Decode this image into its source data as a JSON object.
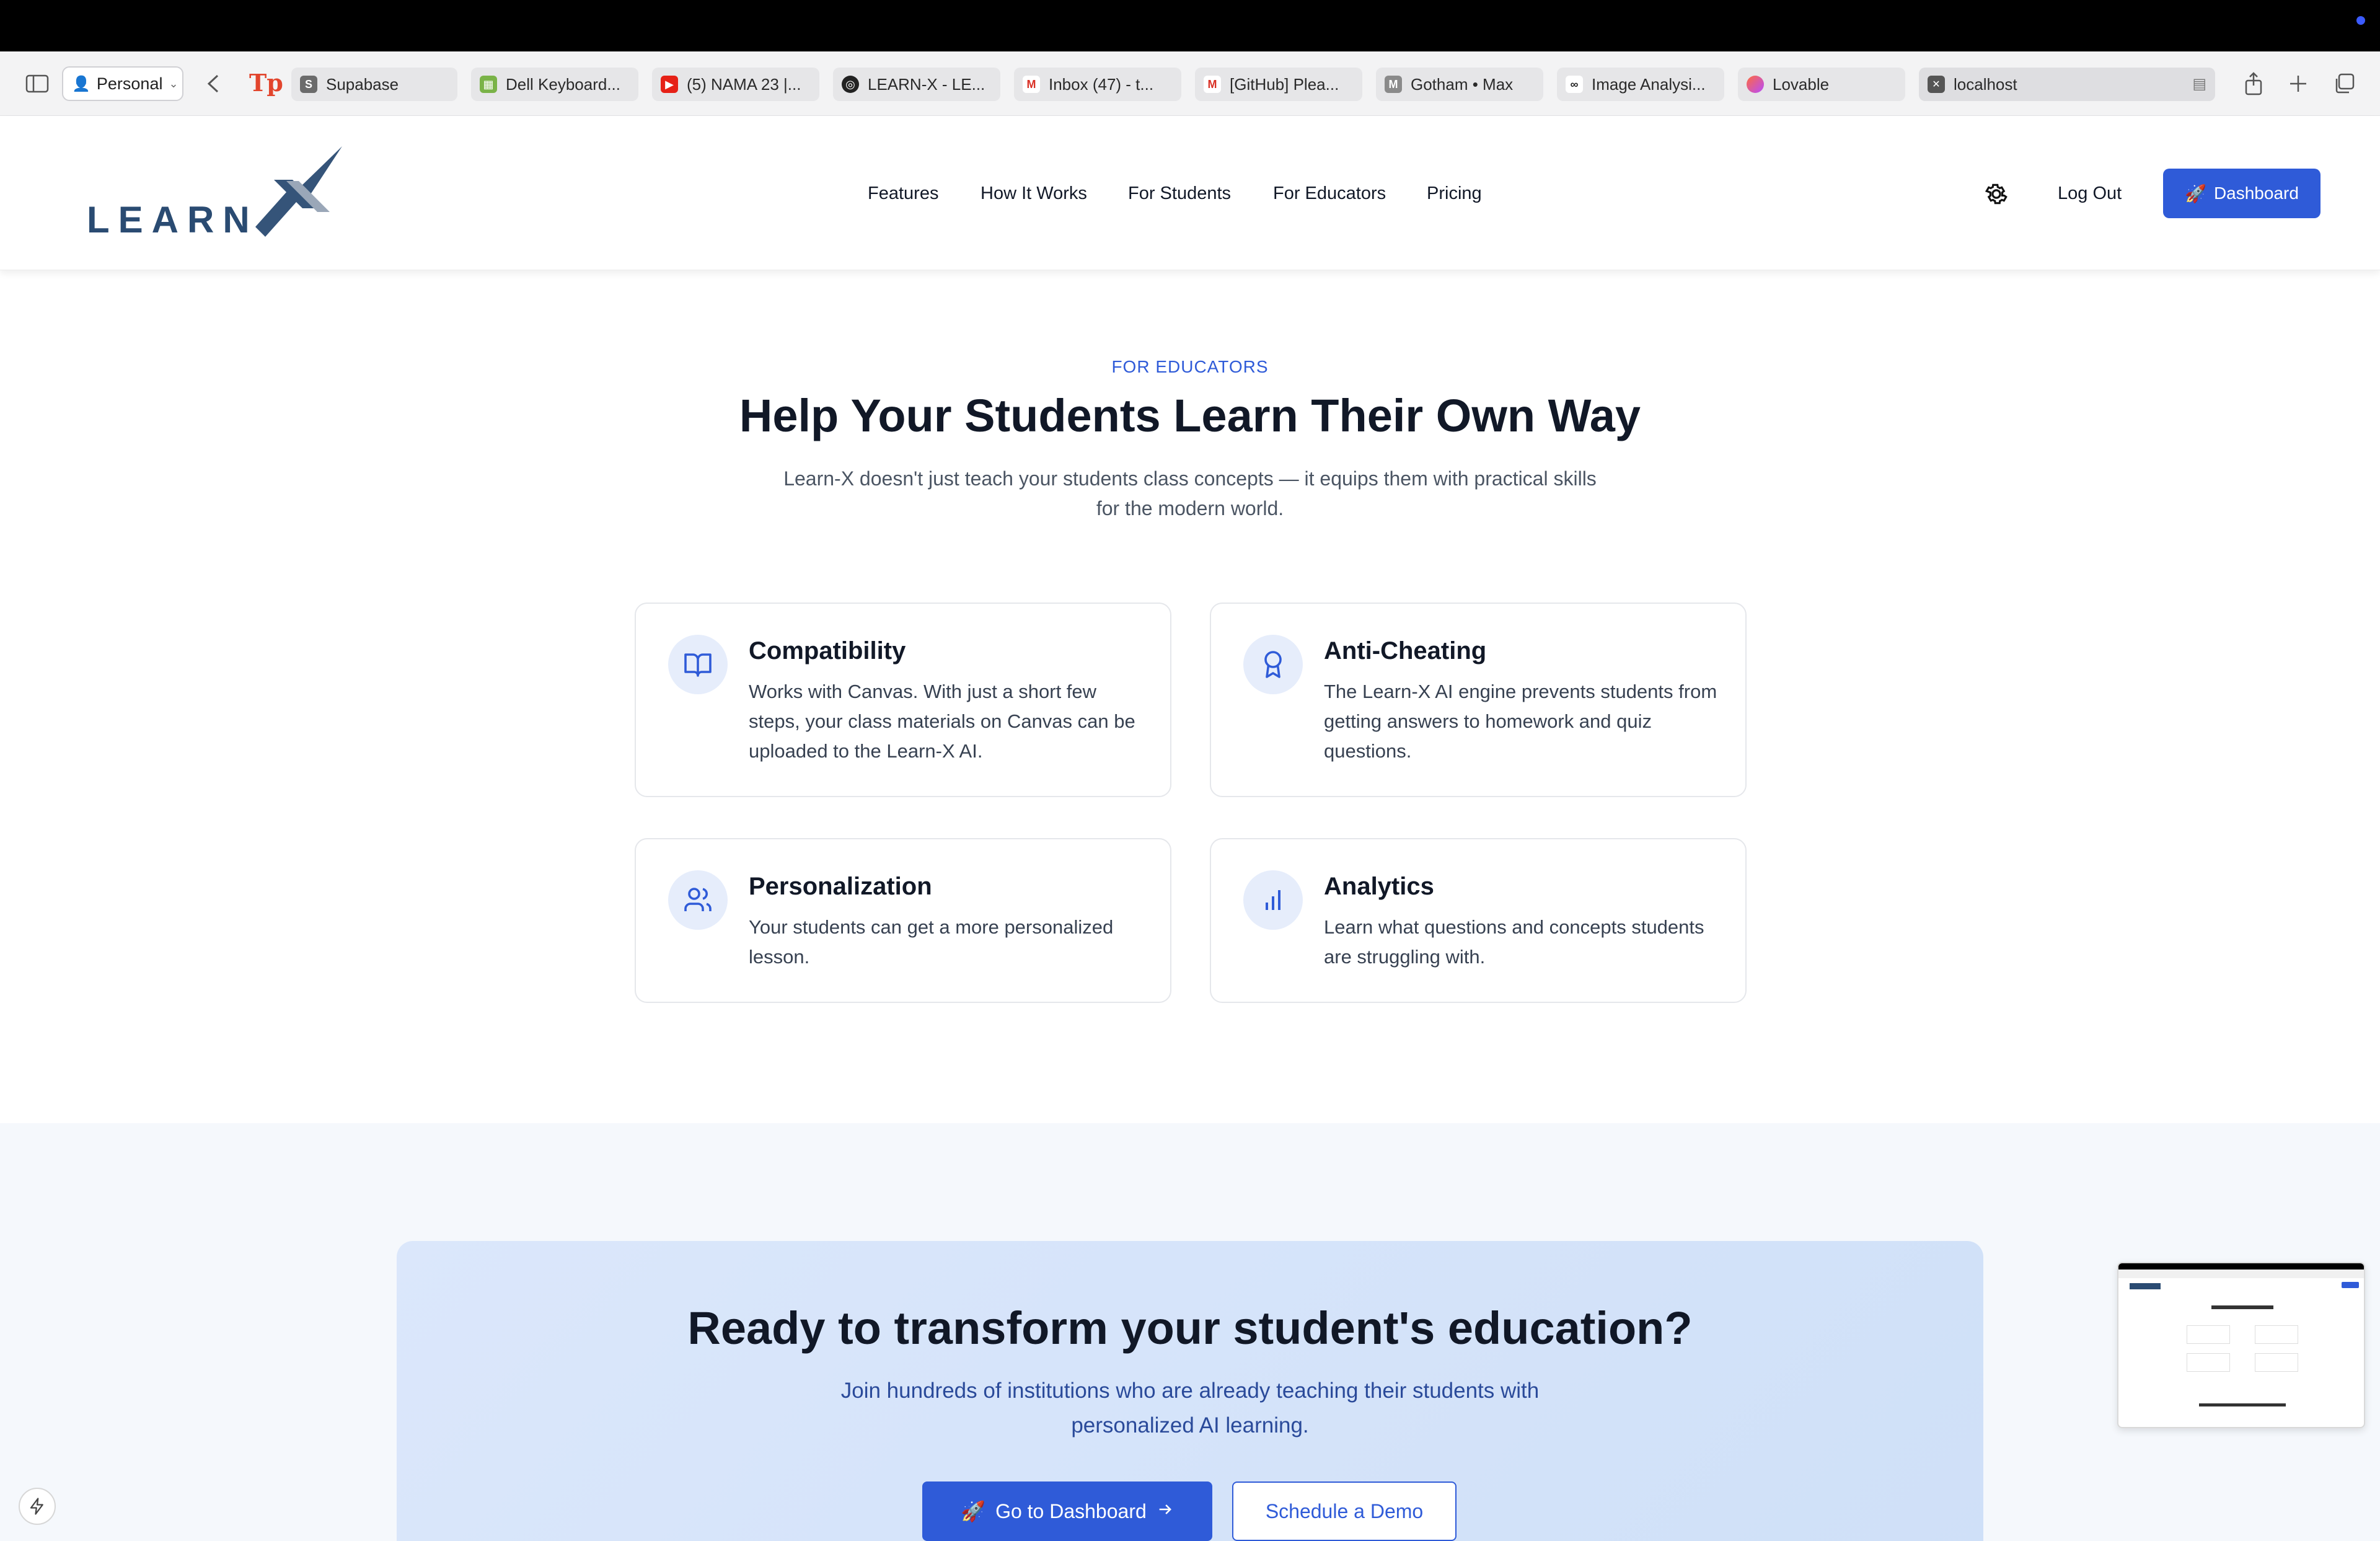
{
  "browser": {
    "profile_label": "Personal",
    "tabs": [
      {
        "label": "Supabase",
        "icon": "supabase-icon",
        "color": "#6b6b6b"
      },
      {
        "label": "Dell Keyboard...",
        "icon": "sheet-icon",
        "color": "#7ab348"
      },
      {
        "label": "(5) NAMA 23 |...",
        "icon": "youtube-icon",
        "color": "#e62117"
      },
      {
        "label": "LEARN-X - LE...",
        "icon": "openai-icon",
        "color": "#222222"
      },
      {
        "label": "Inbox (47) - t...",
        "icon": "gmail-icon",
        "color": "#d93025"
      },
      {
        "label": "[GitHub] Plea...",
        "icon": "gmail-icon",
        "color": "#d93025"
      },
      {
        "label": "Gotham • Max",
        "icon": "max-icon",
        "color": "#8a8a8a"
      },
      {
        "label": "Image Analysi...",
        "icon": "vision-icon",
        "color": "#222222"
      },
      {
        "label": "Lovable",
        "icon": "lovable-icon",
        "color": "#f06"
      },
      {
        "label": "localhost",
        "icon": "localhost-icon",
        "color": "#555555"
      }
    ]
  },
  "site": {
    "logo_text": "LEARN",
    "nav": [
      "Features",
      "How It Works",
      "For Students",
      "For Educators",
      "Pricing"
    ],
    "logout_label": "Log Out",
    "dashboard_label": "Dashboard",
    "accent": "#2f5bd8"
  },
  "section": {
    "eyebrow": "FOR EDUCATORS",
    "title": "Help Your Students Learn Their Own Way",
    "lede": "Learn-X doesn't just teach your students class concepts — it equips them with practical skills for the modern world.",
    "cards": [
      {
        "title": "Compatibility",
        "icon": "book-icon",
        "text": "Works with Canvas. With just a short few steps, your class materials on Canvas can be uploaded to the Learn-X AI."
      },
      {
        "title": "Anti-Cheating",
        "icon": "award-icon",
        "text": "The Learn-X AI engine prevents students from getting answers to homework and quiz questions."
      },
      {
        "title": "Personalization",
        "icon": "users-icon",
        "text": "Your students can get a more personalized lesson."
      },
      {
        "title": "Analytics",
        "icon": "bar-chart-icon",
        "text": "Learn what questions and concepts students are struggling with."
      }
    ]
  },
  "cta": {
    "title": "Ready to transform your student's education?",
    "text": "Join hundreds of institutions who are already teaching their students with personalized AI learning.",
    "primary_label": "Go to Dashboard",
    "secondary_label": "Schedule a Demo"
  }
}
